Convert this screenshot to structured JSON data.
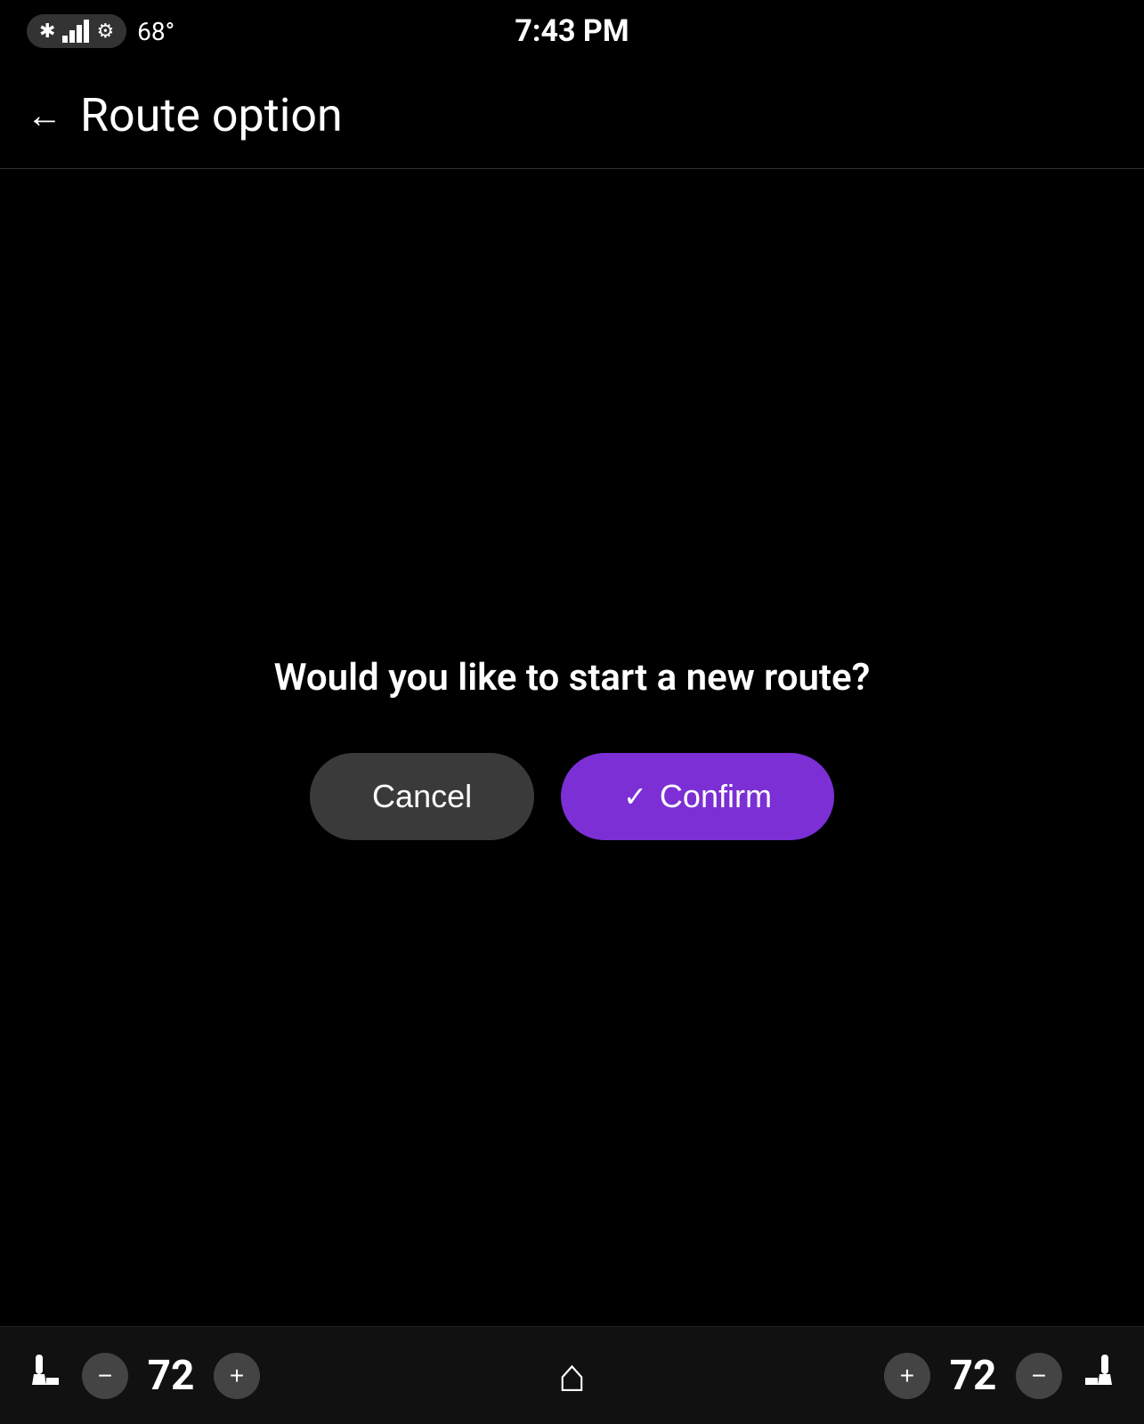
{
  "statusBar": {
    "temperature": "68°",
    "time": "7:43 PM"
  },
  "header": {
    "backLabel": "←",
    "title": "Route option"
  },
  "dialog": {
    "question": "Would you like to start a new route?",
    "cancelLabel": "Cancel",
    "confirmLabel": "Confirm"
  },
  "bottomBar": {
    "leftSeatCount": "72",
    "rightSeatCount": "72"
  },
  "colors": {
    "background": "#000000",
    "confirmButton": "#7b2fd4",
    "cancelButton": "#3a3a3a"
  }
}
